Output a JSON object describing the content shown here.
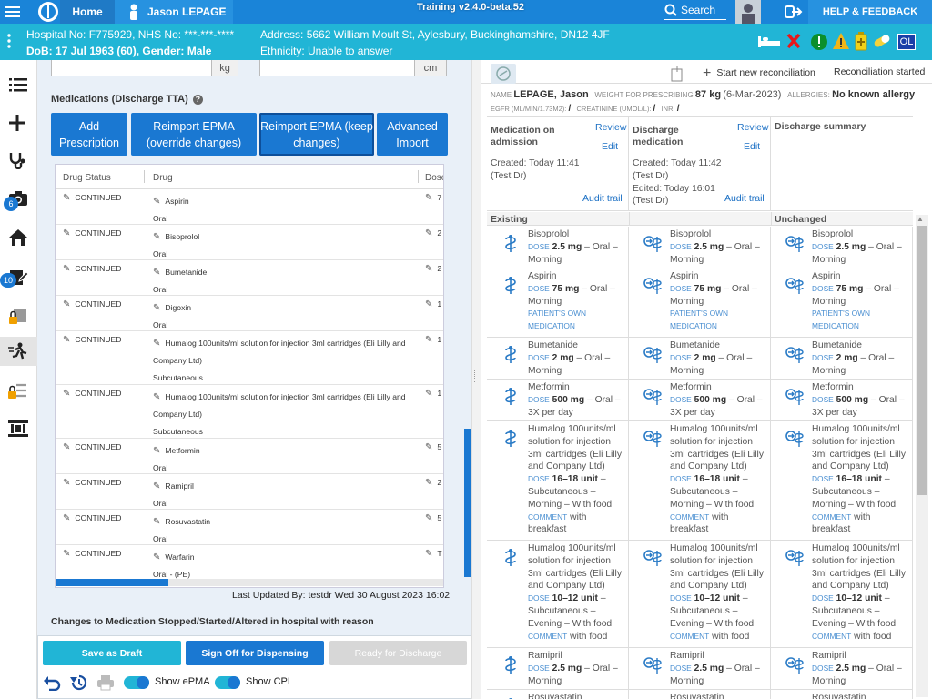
{
  "topbar": {
    "home": "Home",
    "user": "Jason LEPAGE",
    "version": "Training v2.4.0-beta.52",
    "search": "Search",
    "help": "HELP & FEEDBACK"
  },
  "patient": {
    "hospital": "Hospital No: F775929, NHS No: ***-***-****",
    "dob": "DoB: 17 Jul 1963 (60), Gender: Male",
    "address": "Address: 5662 William Moult St, Aylesbury, Buckinghamshire, DN12 4JF",
    "ethnicity": "Ethnicity: Unable to answer",
    "badge": "OL"
  },
  "rail": {
    "badges": [
      "6",
      "10"
    ]
  },
  "left": {
    "unit_kg": "kg",
    "unit_cm": "cm",
    "section_title": "Medications (Discharge TTA)",
    "buttons": [
      "Add Prescription",
      "Reimport EPMA (override changes)",
      "Reimport EPMA (keep changes)",
      "Advanced Import"
    ],
    "table_headers": [
      "Drug Status",
      "Drug",
      "Dose"
    ],
    "rows": [
      {
        "status": "CONTINUED",
        "drug": "Aspirin",
        "route": "Oral",
        "dose": "7"
      },
      {
        "status": "CONTINUED",
        "drug": "Bisoprolol",
        "route": "Oral",
        "dose": "2"
      },
      {
        "status": "CONTINUED",
        "drug": "Bumetanide",
        "route": "Oral",
        "dose": "2"
      },
      {
        "status": "CONTINUED",
        "drug": "Digoxin",
        "route": "Oral",
        "dose": "1"
      },
      {
        "status": "CONTINUED",
        "drug": "Humalog 100units/ml solution for injection 3ml cartridges (Eli Lilly and Company Ltd)",
        "route": "Subcutaneous",
        "dose": "1"
      },
      {
        "status": "CONTINUED",
        "drug": "Humalog 100units/ml solution for injection 3ml cartridges (Eli Lilly and Company Ltd)",
        "route": "Subcutaneous",
        "dose": "1"
      },
      {
        "status": "CONTINUED",
        "drug": "Metformin",
        "route": "Oral",
        "dose": "5"
      },
      {
        "status": "CONTINUED",
        "drug": "Ramipril",
        "route": "Oral",
        "dose": "2"
      },
      {
        "status": "CONTINUED",
        "drug": "Rosuvastatin",
        "route": "Oral",
        "dose": "5"
      },
      {
        "status": "CONTINUED",
        "drug": "Warfarin",
        "route": "Oral - (PE)",
        "dose": "T"
      }
    ],
    "last_updated": "Last Updated By: testdr Wed 30 August 2023 16:02",
    "changes_title": "Changes to Medication Stopped/Started/Altered in hospital with reason",
    "save_draft": "Save as Draft",
    "sign_off": "Sign Off for Dispensing",
    "ready": "Ready for Discharge",
    "show_epma": "Show ePMA",
    "show_cpl": "Show CPL"
  },
  "right": {
    "new_recon": "Start new reconciliation",
    "recon_started": "Reconciliation started",
    "name_label": "NAME",
    "name": "LEPAGE, Jason",
    "weight_label": "WEIGHT FOR PRESCRIBING",
    "weight": "87 kg",
    "weight_date": "(6-Mar-2023)",
    "allergy_label": "ALLERGIES:",
    "allergy": "No known allergy",
    "egfr_label": "EGFR (ML/MIN/1.73M2):",
    "egfr": "/",
    "creat_label": "CREATININE (UMOL/L):",
    "creat": "/",
    "inr_label": "INR:",
    "inr": "/",
    "col1_title": "Medication on admission",
    "col2_title": "Discharge medication",
    "col3_title": "Discharge summary",
    "review": "Review",
    "edit": "Edit",
    "audit": "Audit trail",
    "col1_created": "Created: Today 11:41",
    "col1_by": "(Test Dr)",
    "col2_created": "Created: Today 11:42",
    "col2_by": "(Test Dr)",
    "col2_edited": "Edited: Today 16:01",
    "col2_by2": "(Test Dr)",
    "existing": "Existing",
    "unchanged": "Unchanged",
    "meds": [
      {
        "name": "Bisoprolol",
        "dose_label": "DOSE",
        "dose": "2.5 mg",
        "rest": "– Oral – Morning",
        "own": ""
      },
      {
        "name": "Aspirin",
        "dose_label": "DOSE",
        "dose": "75 mg",
        "rest": "– Oral – Morning",
        "own": "PATIENT'S OWN MEDICATION"
      },
      {
        "name": "Bumetanide",
        "dose_label": "DOSE",
        "dose": "2 mg",
        "rest": "– Oral – Morning",
        "own": ""
      },
      {
        "name": "Metformin",
        "dose_label": "DOSE",
        "dose": "500 mg",
        "rest": "– Oral – 3X per day",
        "own": ""
      },
      {
        "name": "Humalog 100units/ml solution for injection 3ml cartridges (Eli Lilly and Company Ltd)",
        "dose_label": "DOSE",
        "dose": "16–18 unit",
        "rest": "– Subcutaneous – Morning – With food",
        "own": "",
        "comment_label": "COMMENT",
        "comment": "with breakfast"
      },
      {
        "name": "Humalog 100units/ml solution for injection 3ml cartridges (Eli Lilly and Company Ltd)",
        "dose_label": "DOSE",
        "dose": "10–12 unit",
        "rest": "– Subcutaneous – Evening – With food",
        "own": "",
        "comment_label": "COMMENT",
        "comment": "with food"
      },
      {
        "name": "Ramipril",
        "dose_label": "DOSE",
        "dose": "2.5 mg",
        "rest": "– Oral – Morning",
        "own": ""
      },
      {
        "name": "Rosuvastatin",
        "dose_label": "",
        "dose": "",
        "rest": "",
        "own": ""
      }
    ]
  }
}
